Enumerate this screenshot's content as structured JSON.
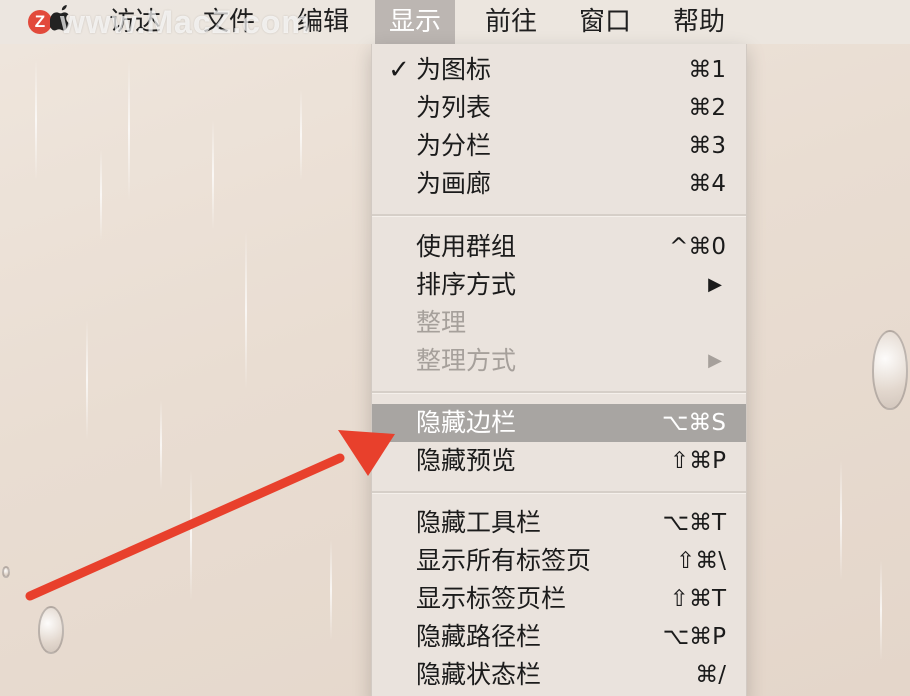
{
  "watermark": "www.MacZ.com",
  "logo": "Z",
  "menubar": {
    "items": [
      {
        "label": "访达"
      },
      {
        "label": "文件"
      },
      {
        "label": "编辑"
      },
      {
        "label": "显示"
      },
      {
        "label": "前往"
      },
      {
        "label": "窗口"
      },
      {
        "label": "帮助"
      }
    ],
    "active_index": 3
  },
  "view_menu": {
    "groups": [
      [
        {
          "label": "为图标",
          "shortcut": "⌘1",
          "checked": true
        },
        {
          "label": "为列表",
          "shortcut": "⌘2"
        },
        {
          "label": "为分栏",
          "shortcut": "⌘3"
        },
        {
          "label": "为画廊",
          "shortcut": "⌘4"
        }
      ],
      [
        {
          "label": "使用群组",
          "shortcut": "^⌘0"
        },
        {
          "label": "排序方式",
          "submenu": true
        },
        {
          "label": "整理",
          "disabled": true
        },
        {
          "label": "整理方式",
          "submenu": true,
          "disabled": true
        }
      ],
      [
        {
          "label": "隐藏边栏",
          "shortcut": "⌥⌘S",
          "selected": true
        },
        {
          "label": "隐藏预览",
          "shortcut": "⇧⌘P"
        }
      ],
      [
        {
          "label": "隐藏工具栏",
          "shortcut": "⌥⌘T"
        },
        {
          "label": "显示所有标签页",
          "shortcut": "⇧⌘\\"
        },
        {
          "label": "显示标签页栏",
          "shortcut": "⇧⌘T"
        },
        {
          "label": "隐藏路径栏",
          "shortcut": "⌥⌘P"
        },
        {
          "label": "隐藏状态栏",
          "shortcut": "⌘/"
        }
      ]
    ],
    "check_glyph": "✓",
    "submenu_glyph": "▶"
  },
  "annotation": {
    "arrow_color": "#e8402c"
  }
}
